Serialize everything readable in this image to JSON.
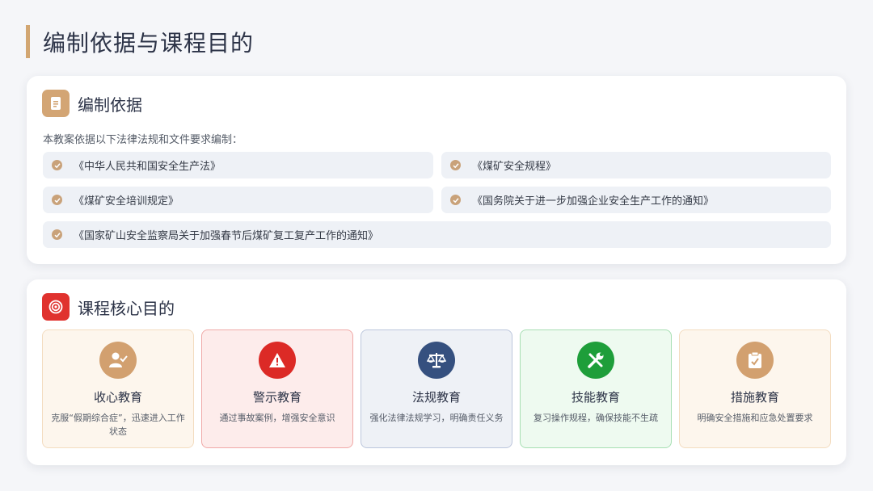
{
  "page": {
    "title": "编制依据与课程目的"
  },
  "basis": {
    "title": "编制依据",
    "intro": "本教案依据以下法律法规和文件要求编制：",
    "items": [
      "《中华人民共和国安全生产法》",
      "《煤矿安全规程》",
      "《煤矿安全培训规定》",
      "《国务院关于进一步加强企业安全生产工作的通知》",
      "《国家矿山安全监察局关于加强春节后煤矿复工复产工作的通知》"
    ],
    "icon": "document-icon",
    "accent": "#d3a574"
  },
  "goals": {
    "title": "课程核心目的",
    "icon": "target-icon",
    "accent": "#e0322e",
    "items": [
      {
        "title": "收心教育",
        "desc": "克服“假期综合症”，迅速进入工作状态",
        "icon": "user-check-icon",
        "color": "#d2a06f"
      },
      {
        "title": "警示教育",
        "desc": "通过事故案例，增强安全意识",
        "icon": "warning-icon",
        "color": "#dc2a26"
      },
      {
        "title": "法规教育",
        "desc": "强化法律法规学习，明确责任义务",
        "icon": "scale-icon",
        "color": "#35507f"
      },
      {
        "title": "技能教育",
        "desc": "复习操作规程，确保技能不生疏",
        "icon": "tools-icon",
        "color": "#1e9e3a"
      },
      {
        "title": "措施教育",
        "desc": "明确安全措施和应急处置要求",
        "icon": "clipboard-check-icon",
        "color": "#d2a06f"
      }
    ]
  }
}
